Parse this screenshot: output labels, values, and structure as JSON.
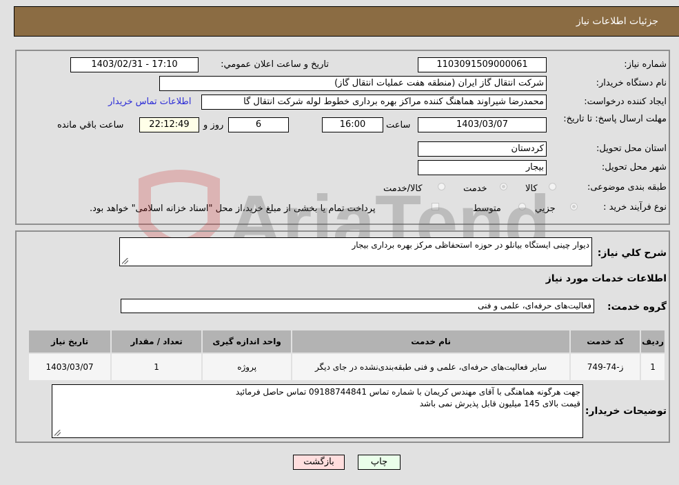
{
  "header": {
    "title": "جزئیات اطلاعات نیاز"
  },
  "details": {
    "need_number": {
      "label": "شماره نیاز:",
      "value": "1103091509000061"
    },
    "announce_datetime": {
      "label": "تاریخ و ساعت اعلان عمومي:",
      "value": "1403/02/31 - 17:10"
    },
    "buyer_org": {
      "label": "نام دستگاه خریدار:",
      "value": "شرکت انتقال گاز ایران (منطقه هفت عملیات انتقال گاز)"
    },
    "requester": {
      "label": "ایجاد کننده درخواست:",
      "value": "محمدرضا شیراوند هماهنگ کننده مراکز بهره برداری خطوط لوله  شرکت انتقال گا",
      "contact_link": "اطلاعات تماس خریدار"
    },
    "deadline": {
      "label": "مهلت ارسال پاسخ: تا تاریخ:",
      "date": "1403/03/07",
      "time_label": "ساعت",
      "time": "16:00",
      "days": "6",
      "days_label": "روز و",
      "remaining": "22:12:49",
      "remaining_label": "ساعت باقي مانده"
    },
    "province": {
      "label": "استان محل تحویل:",
      "value": "کردستان"
    },
    "city": {
      "label": "شهر محل تحویل:",
      "value": "بیجار"
    },
    "category": {
      "label": "طبقه بندی موضوعی:",
      "options": [
        "کالا",
        "خدمت",
        "کالا/خدمت"
      ],
      "selected": "خدمت"
    },
    "purchase_type": {
      "label": "نوع فرآیند خرید :",
      "options": [
        "جزيي",
        "متوسط"
      ],
      "selected": "جزيي",
      "treasury_note": "پرداخت تمام یا بخشی از مبلغ خرید،از محل \"اسناد خزانه اسلامی\" خواهد بود."
    }
  },
  "description": {
    "label": "شرح کلي نیاز:",
    "value": "دیوار چینی ایستگاه بیانلو در حوزه استحفاظی مرکز بهره برداری بیجار"
  },
  "services": {
    "section_title": "اطلاعات خدمات مورد نیاز",
    "group_label": "گروه خدمت:",
    "group_value": "فعالیت‌های حرفه‌ای، علمی و فنی",
    "columns": [
      "ردیف",
      "کد خدمت",
      "نام خدمت",
      "واحد اندازه گیری",
      "تعداد / مقدار",
      "تاریخ نیاز"
    ],
    "rows": [
      {
        "row": "1",
        "code": "ز-74-749",
        "name": "سایر فعالیت‌های حرفه‌ای، علمی و فنی طبقه‌بندی‌نشده در جای دیگر",
        "unit": "پروژه",
        "qty": "1",
        "date": "1403/03/07"
      }
    ]
  },
  "buyer_notes": {
    "label": "توضیحات خریدار:",
    "lines": [
      "جهت هرگونه هماهنگی با آقای مهندس کریمان با شماره تماس 09188744841 تماس حاصل فرمائید",
      "قیمت بالای 145 میلیون قابل پذیرش نمی باشد"
    ]
  },
  "buttons": {
    "print": "چاپ",
    "back": "بازگشت"
  },
  "watermark": {
    "text": "AriaTender.neT"
  },
  "colors": {
    "header_bg": "#8b6c43",
    "link": "#2b2bd6",
    "back_btn": "#ffdede",
    "print_btn": "#eaffea",
    "remaining_bg": "#ffffe8"
  }
}
